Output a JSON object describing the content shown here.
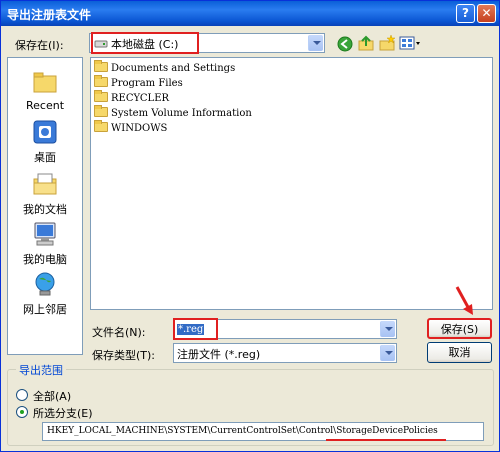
{
  "window": {
    "title": "导出注册表文件",
    "help_label": "?",
    "close_label": "✕"
  },
  "location": {
    "label": "保存在(I):",
    "value": "本地磁盘 (C:)",
    "icon": "drive-icon"
  },
  "toolbar": {
    "back_icon": "back-arrow-icon",
    "up_icon": "up-folder-icon",
    "new_folder_icon": "new-folder-icon",
    "view_icon": "view-menu-icon"
  },
  "places": [
    {
      "label": "Recent",
      "icon": "recent-icon"
    },
    {
      "label": "桌面",
      "icon": "desktop-icon"
    },
    {
      "label": "我的文档",
      "icon": "my-documents-icon"
    },
    {
      "label": "我的电脑",
      "icon": "my-computer-icon"
    },
    {
      "label": "网上邻居",
      "icon": "network-places-icon"
    }
  ],
  "files": [
    {
      "name": "Documents and Settings"
    },
    {
      "name": "Program Files"
    },
    {
      "name": "RECYCLER"
    },
    {
      "name": "System Volume Information"
    },
    {
      "name": "WINDOWS"
    }
  ],
  "filename": {
    "label": "文件名(N):",
    "value": "*.reg"
  },
  "filetype": {
    "label": "保存类型(T):",
    "value": "注册文件 (*.reg)"
  },
  "buttons": {
    "save": "保存(S)",
    "cancel": "取消"
  },
  "export_range": {
    "title": "导出范围",
    "option_all": "全部(A)",
    "option_branch": "所选分支(E)",
    "selected": "branch",
    "branch_path": "HKEY_LOCAL_MACHINE\\SYSTEM\\CurrentControlSet\\Control\\StorageDevicePolicies"
  },
  "colors": {
    "title_bar": "#0a5fd8",
    "annotation": "#e02020",
    "window_bg": "#ece9d8"
  }
}
